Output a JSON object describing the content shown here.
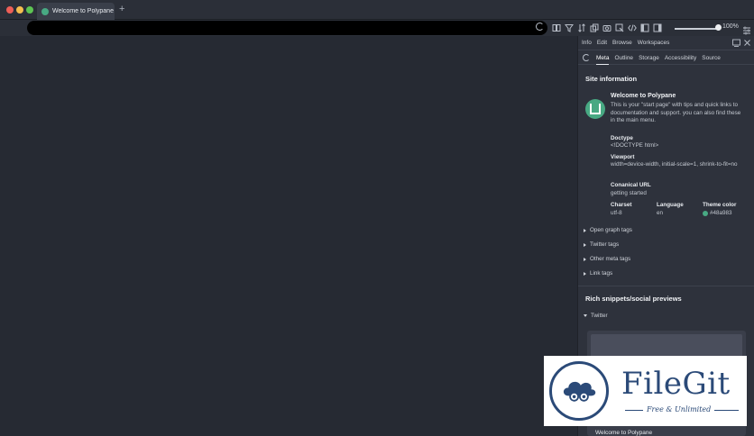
{
  "window": {
    "tab_title": "Welcome to Polypane",
    "new_tab_label": "+"
  },
  "toolbar": {
    "zoom_label": "100%"
  },
  "panel": {
    "tabs": [
      "Info",
      "Edit",
      "Browse",
      "Workspaces"
    ],
    "sub_tabs": [
      "Meta",
      "Outline",
      "Storage",
      "Accessibility",
      "Source"
    ],
    "active_sub_tab": "Meta",
    "site_info": {
      "heading": "Site information",
      "name": "Welcome to Polypane",
      "description": "This is your \"start page\" with tips and quick links to documentation and support. you can also find these in the main menu.",
      "doctype_label": "Doctype",
      "doctype_value": "<!DOCTYPE html>",
      "viewport_label": "Viewport",
      "viewport_value": "width=device-width, initial-scale=1, shrink-to-fit=no",
      "canonical_label": "Conanical URL",
      "canonical_value": "getting started",
      "charset_label": "Charset",
      "charset_value": "utf-8",
      "language_label": "Language",
      "language_value": "en",
      "theme_label": "Theme color",
      "theme_value": "#48a983"
    },
    "collapsibles": [
      "Open graph tags",
      "Twitter tags",
      "Other meta tags",
      "Link tags"
    ],
    "rich": {
      "heading": "Rich snippets/social previews",
      "twitter_label": "Twitter",
      "preview_title": "Welcome to Polypane"
    }
  },
  "watermark": {
    "brand": "FileGit",
    "tagline": "Free & Unlimited"
  },
  "colors": {
    "theme": "#48a983",
    "background": "#262a33",
    "panel": "#2e323c"
  }
}
